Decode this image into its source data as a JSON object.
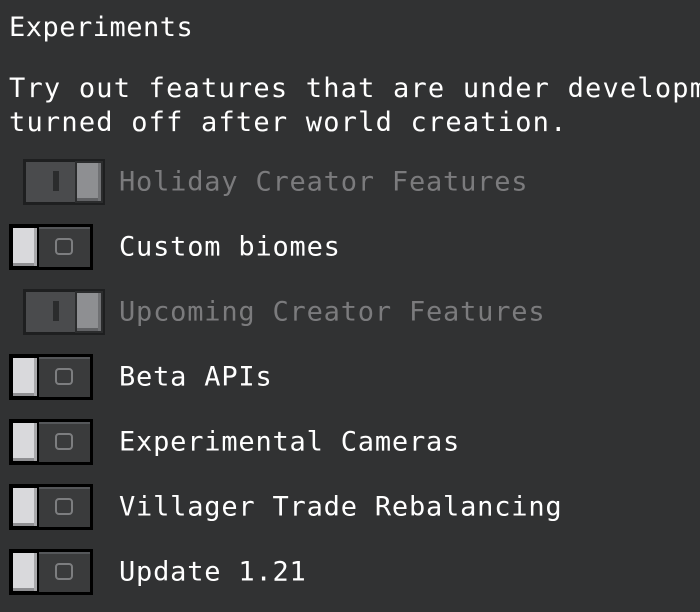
{
  "header": {
    "title": "Experiments"
  },
  "description": {
    "line1": "Try out features that are under developm",
    "line2": "turned off after world creation."
  },
  "toggles": [
    {
      "label": "Holiday Creator Features",
      "state": "on",
      "enabled": false
    },
    {
      "label": "Custom biomes",
      "state": "off",
      "enabled": true
    },
    {
      "label": "Upcoming Creator Features",
      "state": "on",
      "enabled": false
    },
    {
      "label": "Beta APIs",
      "state": "off",
      "enabled": true
    },
    {
      "label": "Experimental Cameras",
      "state": "off",
      "enabled": true
    },
    {
      "label": "Villager Trade Rebalancing",
      "state": "off",
      "enabled": true
    },
    {
      "label": "Update 1.21",
      "state": "off",
      "enabled": true
    }
  ],
  "colors": {
    "background": "#313233",
    "text": "#ffffff",
    "disabled_text": "#7b7b7d"
  }
}
